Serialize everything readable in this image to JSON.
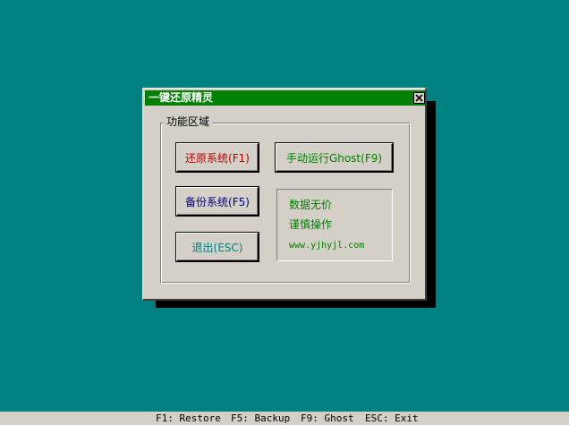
{
  "dialog": {
    "title": "一键还原精灵",
    "group_label": "功能区域",
    "buttons": {
      "restore": "还原系统(F1)",
      "ghost": "手动运行Ghost(F9)",
      "backup": "备份系统(F5)",
      "exit": "退出(ESC)"
    },
    "info": {
      "line1": "数据无价",
      "line2": "谨慎操作",
      "line3": "www.yjhyjl.com"
    }
  },
  "statusbar": {
    "hints": [
      "F1: Restore",
      "F5: Backup",
      "F9: Ghost",
      "ESC: Exit"
    ]
  },
  "colors": {
    "desktop": "#008080",
    "titlebar": "#008000",
    "dialog_face": "#d4d0c8",
    "restore_text": "#c00000",
    "backup_text": "#000080",
    "exit_text": "#008080",
    "ghost_text": "#008000",
    "info_text": "#008000"
  },
  "icons": {
    "close": "close-icon"
  }
}
